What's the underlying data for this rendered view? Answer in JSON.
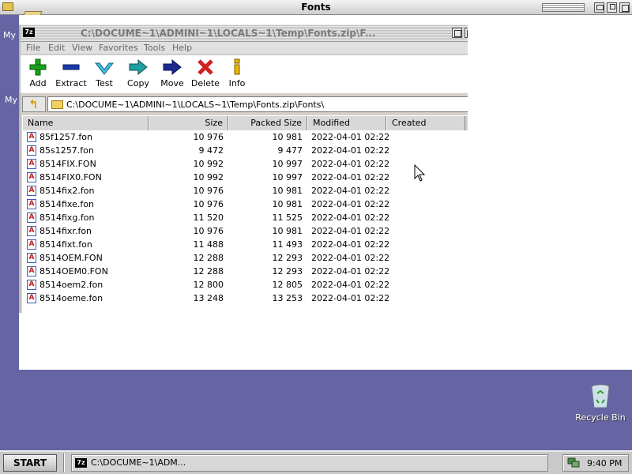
{
  "outer_window": {
    "title": "Fonts"
  },
  "desktop": {
    "fragments": [
      "My",
      "My"
    ],
    "recycle_bin_label": "Recycle Bin"
  },
  "zip_window": {
    "title": "C:\\DOCUME~1\\ADMINI~1\\LOCALS~1\\Temp\\Fonts.zip\\F...",
    "logo": "7z",
    "menu": [
      "File",
      "Edit",
      "View",
      "Favorites",
      "Tools",
      "Help"
    ],
    "toolbar": [
      {
        "label": "Add",
        "icon": "plus-icon",
        "color": "#1aa01a"
      },
      {
        "label": "Extract",
        "icon": "minus-icon",
        "color": "#1a3aa8"
      },
      {
        "label": "Test",
        "icon": "check-icon",
        "color": "#20a0c0"
      },
      {
        "label": "Copy",
        "icon": "copy-arrow-icon",
        "color": "#20a0a0"
      },
      {
        "label": "Move",
        "icon": "move-arrow-icon",
        "color": "#1a2a90"
      },
      {
        "label": "Delete",
        "icon": "delete-x-icon",
        "color": "#d02020"
      },
      {
        "label": "Info",
        "icon": "info-icon",
        "color": "#d4a000"
      }
    ],
    "address": "C:\\DOCUME~1\\ADMINI~1\\LOCALS~1\\Temp\\Fonts.zip\\Fonts\\",
    "columns": [
      "Name",
      "Size",
      "Packed Size",
      "Modified",
      "Created"
    ],
    "rows": [
      {
        "name": "85f1257.fon",
        "size": "10 976",
        "packed": "10 981",
        "modified": "2022-04-01 02:22"
      },
      {
        "name": "85s1257.fon",
        "size": "9 472",
        "packed": "9 477",
        "modified": "2022-04-01 02:22"
      },
      {
        "name": "8514FIX.FON",
        "size": "10 992",
        "packed": "10 997",
        "modified": "2022-04-01 02:22"
      },
      {
        "name": "8514FIX0.FON",
        "size": "10 992",
        "packed": "10 997",
        "modified": "2022-04-01 02:22"
      },
      {
        "name": "8514fix2.fon",
        "size": "10 976",
        "packed": "10 981",
        "modified": "2022-04-01 02:22"
      },
      {
        "name": "8514fixe.fon",
        "size": "10 976",
        "packed": "10 981",
        "modified": "2022-04-01 02:22"
      },
      {
        "name": "8514fixg.fon",
        "size": "11 520",
        "packed": "11 525",
        "modified": "2022-04-01 02:22"
      },
      {
        "name": "8514fixr.fon",
        "size": "10 976",
        "packed": "10 981",
        "modified": "2022-04-01 02:22"
      },
      {
        "name": "8514fixt.fon",
        "size": "11 488",
        "packed": "11 493",
        "modified": "2022-04-01 02:22"
      },
      {
        "name": "8514OEM.FON",
        "size": "12 288",
        "packed": "12 293",
        "modified": "2022-04-01 02:22"
      },
      {
        "name": "8514OEM0.FON",
        "size": "12 288",
        "packed": "12 293",
        "modified": "2022-04-01 02:22"
      },
      {
        "name": "8514oem2.fon",
        "size": "12 800",
        "packed": "12 805",
        "modified": "2022-04-01 02:22"
      },
      {
        "name": "8514oeme.fon",
        "size": "13 248",
        "packed": "13 253",
        "modified": "2022-04-01 02:22"
      }
    ]
  },
  "taskbar": {
    "start_label": "START",
    "task_label": "C:\\DOCUME~1\\ADM...",
    "task_logo": "7z",
    "clock": "9:40 PM"
  }
}
